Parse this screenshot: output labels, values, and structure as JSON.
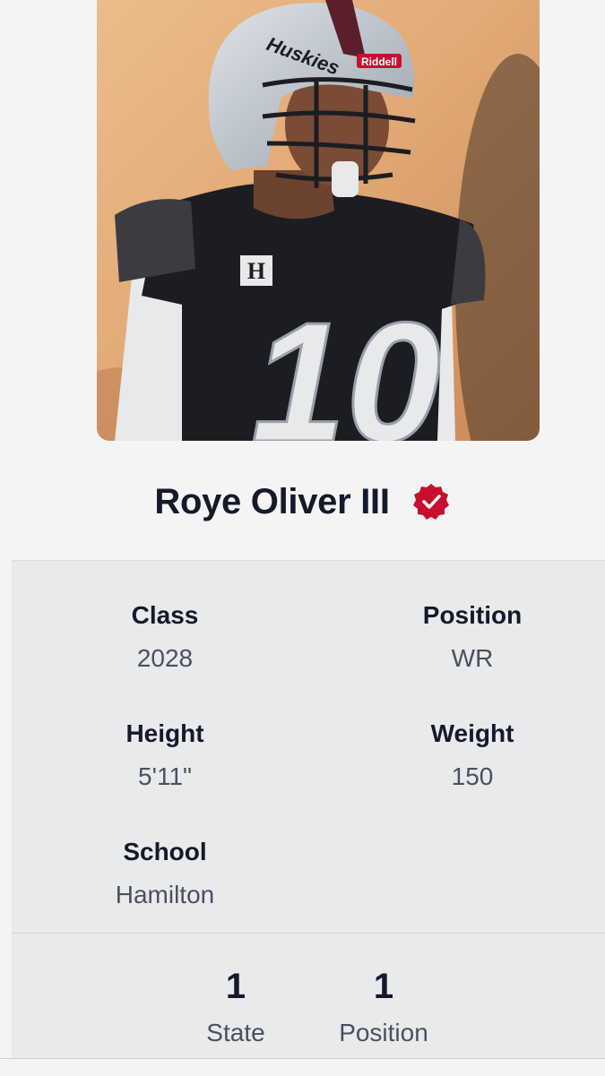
{
  "player": {
    "name": "Roye Oliver III",
    "verified_badge_color": "#c8102e",
    "photo": {
      "helmet_text": "Huskies",
      "helmet_brand": "Riddell",
      "jersey_number": "10",
      "chest_logo": "H"
    }
  },
  "info": {
    "class_label": "Class",
    "class_value": "2028",
    "position_label": "Position",
    "position_value": "WR",
    "height_label": "Height",
    "height_value": "5'11\"",
    "weight_label": "Weight",
    "weight_value": "150",
    "school_label": "School",
    "school_value": "Hamilton"
  },
  "rankings": {
    "state_rank": "1",
    "state_label": "State",
    "position_rank": "1",
    "position_label": "Position"
  }
}
